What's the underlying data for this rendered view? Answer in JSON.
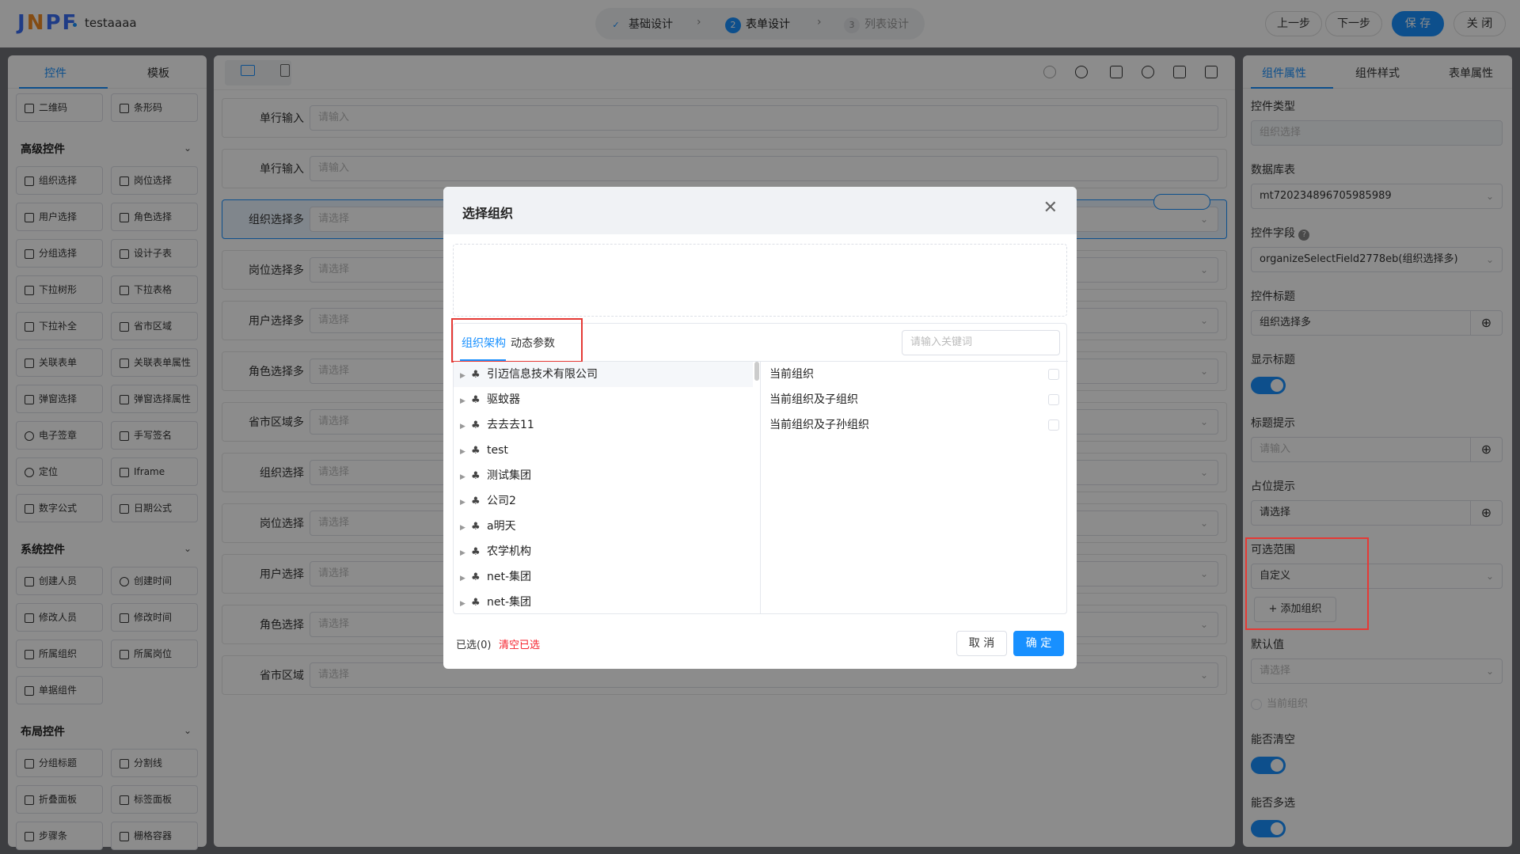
{
  "app": {
    "logo": "JNPF",
    "title": "testaaaa"
  },
  "steps": [
    {
      "num": "✓",
      "label": "基础设计"
    },
    {
      "num": "2",
      "label": "表单设计"
    },
    {
      "num": "3",
      "label": "列表设计"
    }
  ],
  "topbar": {
    "prev": "上一步",
    "next": "下一步",
    "save": "保 存",
    "close": "关 闭"
  },
  "left": {
    "tabs": [
      "控件",
      "模板"
    ],
    "top_items": [
      "二维码",
      "条形码"
    ],
    "sections": [
      {
        "title": "高级控件",
        "items": [
          "组织选择",
          "岗位选择",
          "用户选择",
          "角色选择",
          "分组选择",
          "设计子表",
          "下拉树形",
          "下拉表格",
          "下拉补全",
          "省市区域",
          "关联表单",
          "关联表单属性",
          "弹窗选择",
          "弹窗选择属性",
          "电子签章",
          "手写签名",
          "定位",
          "Iframe",
          "数字公式",
          "日期公式"
        ]
      },
      {
        "title": "系统控件",
        "items": [
          "创建人员",
          "创建时间",
          "修改人员",
          "修改时间",
          "所属组织",
          "所属岗位",
          "单据组件"
        ]
      },
      {
        "title": "布局控件",
        "items": [
          "分组标题",
          "分割线",
          "折叠面板",
          "标签面板",
          "步骤条",
          "栅格容器"
        ]
      }
    ]
  },
  "form_rows": [
    {
      "label": "单行输入",
      "placeholder": "请输入",
      "select": false
    },
    {
      "label": "单行输入",
      "placeholder": "请输入",
      "select": false
    },
    {
      "label": "组织选择多",
      "placeholder": "请选择",
      "select": true
    },
    {
      "label": "岗位选择多",
      "placeholder": "请选择",
      "select": true
    },
    {
      "label": "用户选择多",
      "placeholder": "请选择",
      "select": true
    },
    {
      "label": "角色选择多",
      "placeholder": "请选择",
      "select": true
    },
    {
      "label": "省市区域多",
      "placeholder": "请选择",
      "select": true
    },
    {
      "label": "组织选择",
      "placeholder": "请选择",
      "select": true
    },
    {
      "label": "岗位选择",
      "placeholder": "请选择",
      "select": true
    },
    {
      "label": "用户选择",
      "placeholder": "请选择",
      "select": true
    },
    {
      "label": "角色选择",
      "placeholder": "请选择",
      "select": true
    },
    {
      "label": "省市区域",
      "placeholder": "请选择",
      "select": true
    }
  ],
  "right": {
    "tabs": [
      "组件属性",
      "组件样式",
      "表单属性"
    ],
    "control_type_label": "控件类型",
    "control_type_value": "组织选择",
    "db_table_label": "数据库表",
    "db_table_value": "mt720234896705985989",
    "field_label": "控件字段",
    "field_value": "organizeSelectField2778eb(组织选择多)",
    "title_label": "控件标题",
    "title_value": "组织选择多",
    "show_title_label": "显示标题",
    "tip_label": "标题提示",
    "tip_placeholder": "请输入",
    "placeholder_label": "占位提示",
    "placeholder_value": "请选择",
    "range_label": "可选范围",
    "range_value": "自定义",
    "add_org": "添加组织",
    "default_label": "默认值",
    "default_placeholder": "请选择",
    "current_org": "当前组织",
    "clearable_label": "能否清空",
    "multiple_label": "能否多选"
  },
  "modal": {
    "title": "选择组织",
    "tabs": [
      "组织架构",
      "动态参数"
    ],
    "search_placeholder": "请输入关键词",
    "tree": [
      "引迈信息技术有限公司",
      "驱蚊器",
      "去去去11",
      "test",
      "测试集团",
      "公司2",
      "a明天",
      "农学机构",
      "net-集团",
      "net-集团"
    ],
    "dynamic": [
      "当前组织",
      "当前组织及子组织",
      "当前组织及子孙组织"
    ],
    "selected_count": "已选(0)",
    "clear": "清空已选",
    "cancel": "取 消",
    "confirm": "确 定"
  }
}
